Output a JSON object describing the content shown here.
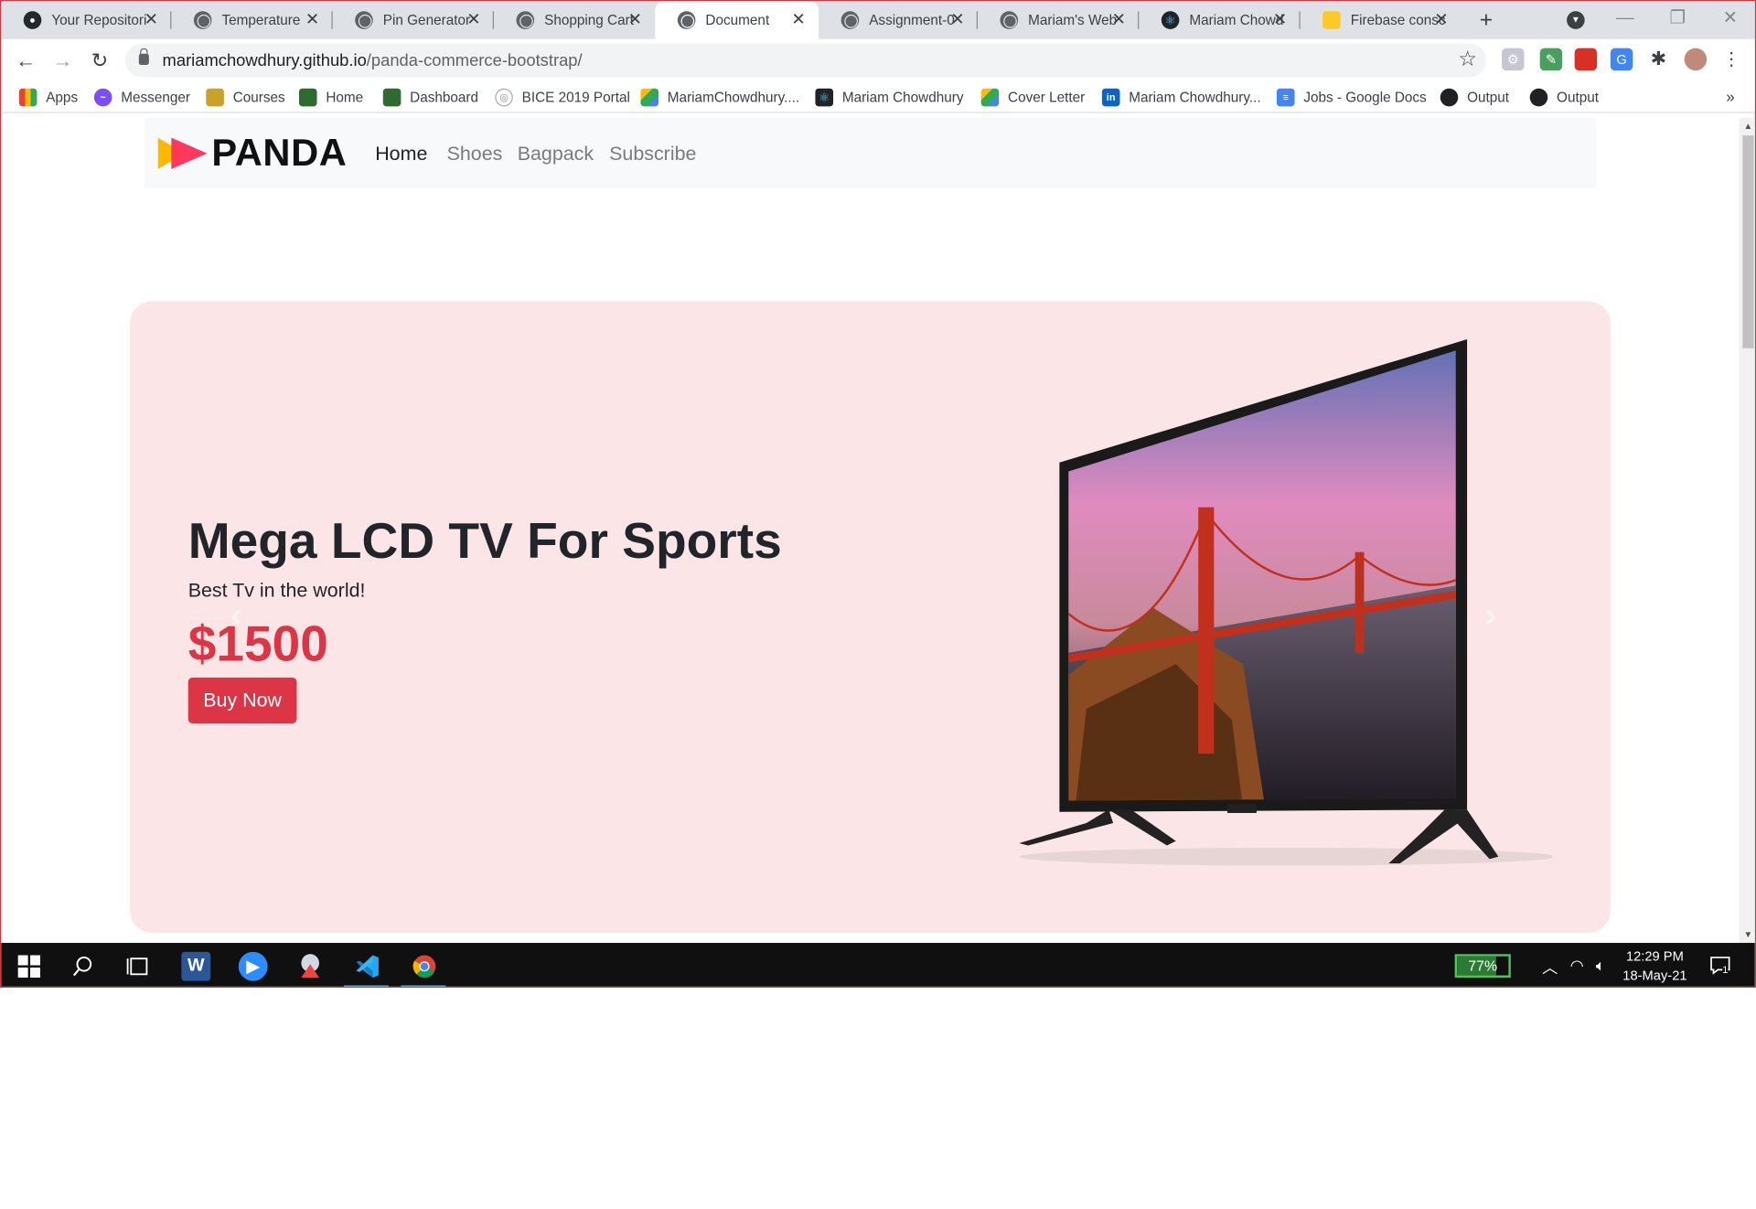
{
  "browser": {
    "tabs": [
      {
        "title": "Your Repositori",
        "icon": "github-icon"
      },
      {
        "title": "Temperature",
        "icon": "globe-icon"
      },
      {
        "title": "Pin Generator",
        "icon": "globe-icon"
      },
      {
        "title": "Shopping Cart",
        "icon": "globe-icon"
      },
      {
        "title": "Document",
        "icon": "globe-icon",
        "active": true
      },
      {
        "title": "Assignment-0",
        "icon": "globe-icon"
      },
      {
        "title": "Mariam's Web",
        "icon": "globe-icon"
      },
      {
        "title": "Mariam Chowd",
        "icon": "react-icon"
      },
      {
        "title": "Firebase consc",
        "icon": "firebase-icon"
      }
    ],
    "url_host": "mariamchowdhury.github.io",
    "url_path": "/panda-commerce-bootstrap/",
    "bookmarks": [
      {
        "label": "Apps",
        "icon": "apps-grid-icon"
      },
      {
        "label": "Messenger",
        "icon": "messenger-icon"
      },
      {
        "label": "Courses",
        "icon": "courses-icon"
      },
      {
        "label": "Home",
        "icon": "shield-icon"
      },
      {
        "label": "Dashboard",
        "icon": "shield-icon"
      },
      {
        "label": "BICE 2019 Portal",
        "icon": "portal-icon"
      },
      {
        "label": "MariamChowdhury....",
        "icon": "drive-icon"
      },
      {
        "label": "Mariam Chowdhury",
        "icon": "react-icon"
      },
      {
        "label": "Cover Letter",
        "icon": "drive-icon"
      },
      {
        "label": "Mariam Chowdhury...",
        "icon": "linkedin-icon"
      },
      {
        "label": "Jobs - Google Docs",
        "icon": "docs-icon"
      },
      {
        "label": "Output",
        "icon": "globe-icon"
      },
      {
        "label": "Output",
        "icon": "globe-icon"
      }
    ]
  },
  "site": {
    "logo_text": "PANDA",
    "nav": [
      "Home",
      "Shoes",
      "Bagpack",
      "Subscribe"
    ],
    "hero": {
      "title": "Mega LCD TV For Sports",
      "subtitle": "Best Tv in the world!",
      "price": "$1500",
      "button": "Buy Now"
    }
  },
  "taskbar": {
    "battery": "77%",
    "battery_level": 0.77,
    "time": "12:29 PM",
    "date": "18-May-21",
    "notifications": "1"
  },
  "colors": {
    "accent": "#dc3545",
    "hero_bg": "#fbe5e6",
    "nav_bg": "#f8f9fa"
  }
}
